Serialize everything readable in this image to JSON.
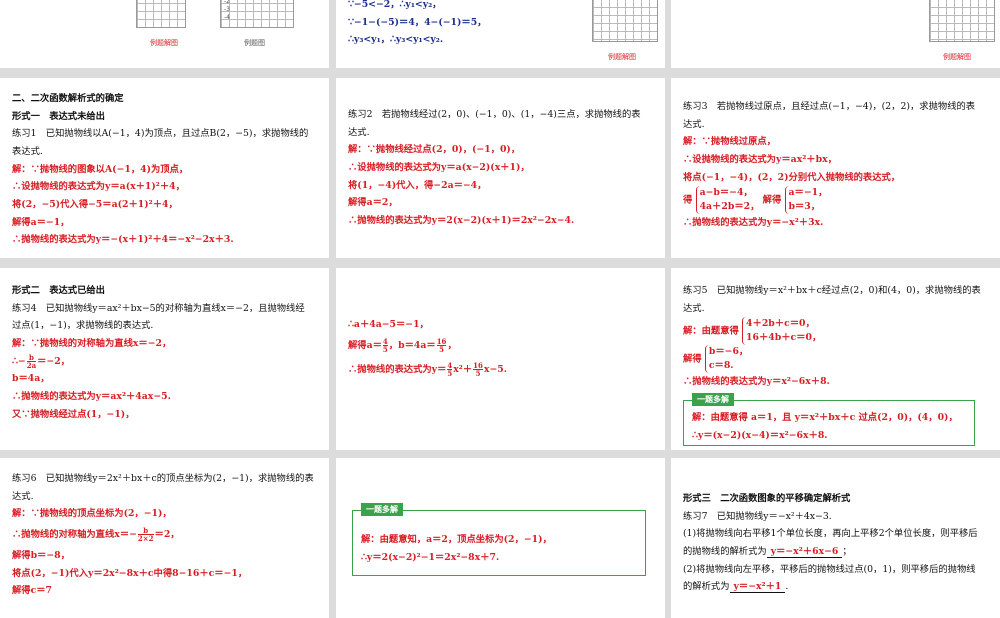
{
  "top": {
    "c1_caption_left": "例题解图",
    "c1_caption_right": "例题图",
    "c1_ticks": [
      "-2",
      "-3",
      "-4"
    ],
    "c2_lines": [
      "∵−5<−2，∴y₁<y₂，",
      "∵−1−(−5)＝4，4−(−1)＝5，",
      "∴y₃<y₁，∴y₃<y₁<y₂."
    ],
    "c2_caption": "例题解图",
    "c3_caption": "例题解图"
  },
  "card_a": {
    "section": "二、二次函数解析式的确定",
    "form": "形式一　表达式未给出",
    "q": "练习1　已知抛物线以A(−1，4)为顶点，且过点B(2，−5)，求抛物线的",
    "q2": "表达式.",
    "s1": "解：∵抛物线的图象以A(−1，4)为顶点，",
    "s2": "∴设抛物线的表达式为y＝a(x＋1)²＋4，",
    "s3": "将(2，−5)代入得−5＝a(2＋1)²＋4，",
    "s4": "解得a＝−1，",
    "s5": "∴抛物线的表达式为y＝−(x＋1)²＋4＝−x²−2x＋3."
  },
  "card_b": {
    "q": "练习2　若抛物线经过(2，0)、(−1，0)、(1，−4)三点，求抛物线的表",
    "q2": "达式.",
    "s1": "解：∵抛物线经过点(2，0)，(−1，0)，",
    "s2": "∴设抛物线的表达式为y＝a(x−2)(x＋1)，",
    "s3": "将(1，−4)代入，得−2a＝−4，",
    "s4": "解得a＝2，",
    "s5": "∴抛物线的表达式为y＝2(x−2)(x＋1)＝2x²−2x−4."
  },
  "card_c": {
    "q": "练习3　若抛物线过原点，且经过点(−1，−4)，(2，2)，求抛物线的表",
    "q2": "达式.",
    "s1": "解：∵抛物线过原点，",
    "s2": "∴设抛物线的表达式为y＝ax²＋bx，",
    "s3": "将点(−1，−4)，(2，2)分别代入抛物线的表达式，",
    "s4_pre": "得",
    "s4_sys1": "a−b＝−4，",
    "s4_sys2": "4a＋2b＝2，",
    "s4_mid": "解得",
    "s4_res1": "a＝−1，",
    "s4_res2": "b＝3，",
    "s5": "∴抛物线的表达式为y＝−x²＋3x."
  },
  "card_d": {
    "form": "形式二　表达式已给出",
    "q": "练习4　已知抛物线y＝ax²＋bx−5的对称轴为直线x＝−2，且抛物线经",
    "q2": "过点(1，−1)，求抛物线的表达式.",
    "s1": "解：∵抛物线的对称轴为直线x＝−2，",
    "s2_pre": "∴−",
    "s2_num": "b",
    "s2_den": "2a",
    "s2_post": "＝−2，",
    "s3": "b＝4a，",
    "s4": "∴抛物线的表达式为y＝ax²＋4ax−5.",
    "s5": "又∵抛物线经过点(1，−1)，"
  },
  "card_e": {
    "s1": "∴a＋4a−5＝−1，",
    "s2_pre": "解得a＝",
    "s2_n1": "4",
    "s2_d1": "5",
    "s2_mid": "，b＝4a＝",
    "s2_n2": "16",
    "s2_d2": "5",
    "s2_post": "，",
    "s3_pre": "∴抛物线的表达式为y＝",
    "s3_n1": "4",
    "s3_d1": "5",
    "s3_mid": "x²＋",
    "s3_n2": "16",
    "s3_d2": "5",
    "s3_post": "x−5."
  },
  "card_f": {
    "q": "练习5　已知抛物线y＝x²＋bx＋c经过点(2，0)和(4，0)，求抛物线的表",
    "q2": "达式.",
    "s1_pre": "解：由题意得",
    "s1_sys1": "4＋2b＋c＝0，",
    "s1_sys2": "16＋4b＋c＝0，",
    "s2_pre": "解得",
    "s2_sys1": "b＝−6，",
    "s2_sys2": "c＝8.",
    "s3": "∴抛物线的表达式为y＝x²−6x＋8.",
    "tag": "一题多解",
    "alt1": "解：由题意得 a＝1，且 y＝x²＋bx＋c 过点(2，0)，(4，0)，",
    "alt2": "∴y＝(x−2)(x−4)＝x²−6x＋8."
  },
  "card_g": {
    "q": "练习6　已知抛物线y＝2x²＋bx＋c的顶点坐标为(2，−1)，求抛物线的表",
    "q2": "达式.",
    "s1": "解：∵抛物线的顶点坐标为(2，−1)，",
    "s2_pre": "∴抛物线的对称轴为直线x＝−",
    "s2_num": "b",
    "s2_den": "2×2",
    "s2_post": "＝2，",
    "s3": "解得b＝−8，",
    "s4": "将点(2，−1)代入y＝2x²−8x＋c中得8−16＋c＝−1，",
    "s5": "解得c＝7"
  },
  "card_h": {
    "tag": "一题多解",
    "alt1": "解：由题意知，a＝2，顶点坐标为(2，−1)，",
    "alt2": "∴y＝2(x−2)²−1＝2x²−8x＋7."
  },
  "card_i": {
    "form": "形式三　二次函数图象的平移确定解析式",
    "q": "练习7　已知抛物线y＝−x²＋4x−3.",
    "p1": "(1)将抛物线向右平移1个单位长度，再向上平移2个单位长度，则平移后",
    "p1b_pre": "的抛物线的解析式为",
    "p1b_ans": "y＝−x²＋6x−6",
    "p1b_post": "；",
    "p2": "(2)将抛物线向左平移，平移后的抛物线过点(0，1)，则平移后的抛物线",
    "p2b_pre": "的解析式为",
    "p2b_ans": "y＝−x²＋1",
    "p2b_post": "."
  }
}
